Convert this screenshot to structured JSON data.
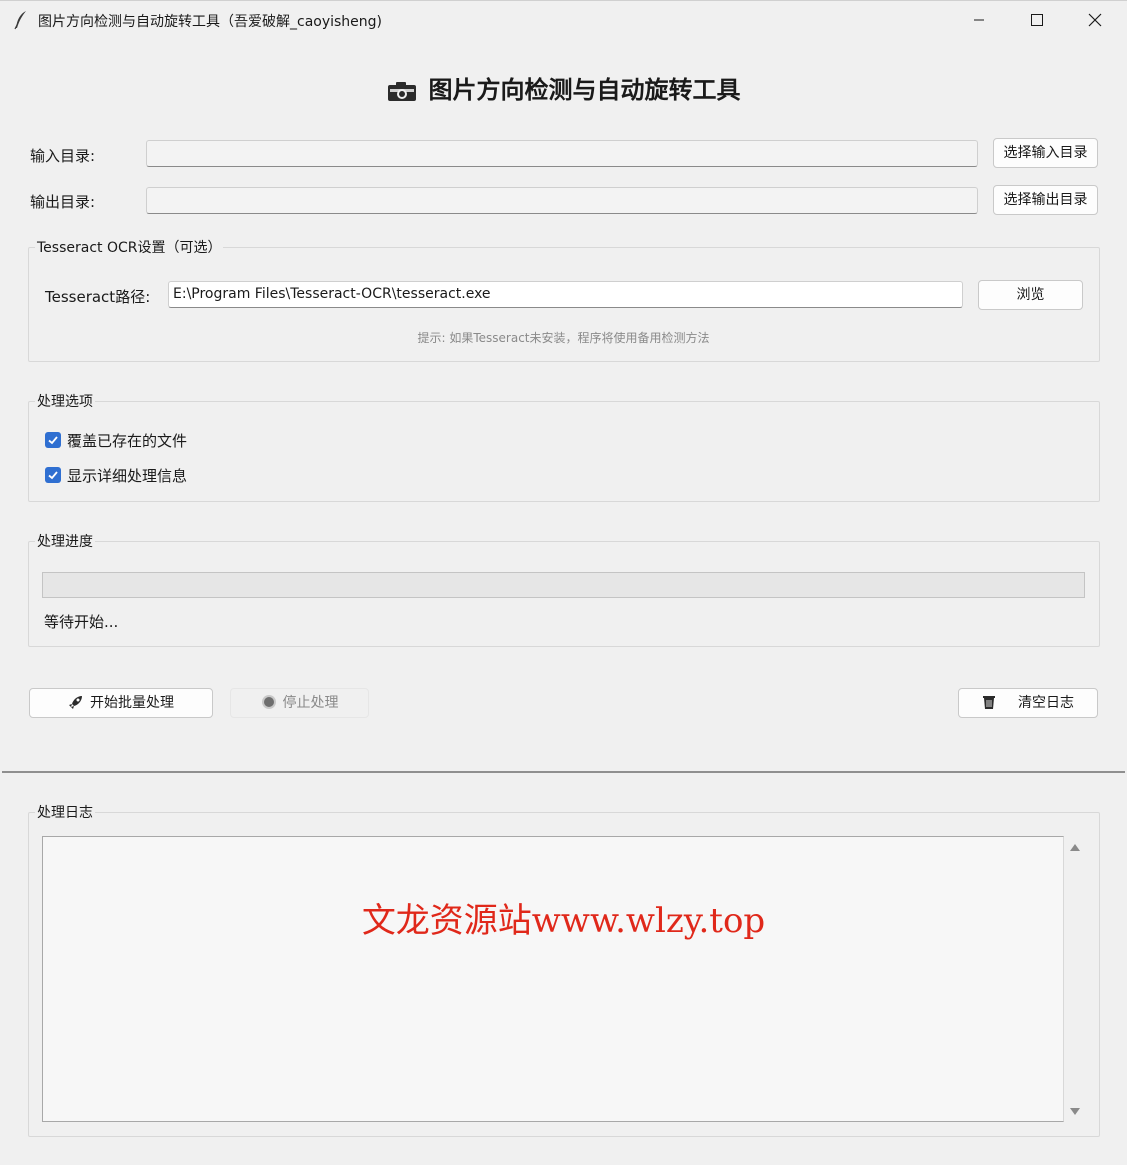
{
  "window": {
    "title": "图片方向检测与自动旋转工具（吾爱破解_caoyisheng)"
  },
  "header": {
    "title": "图片方向检测与自动旋转工具",
    "icon": "camera-icon"
  },
  "paths": {
    "input_label": "输入目录:",
    "input_value": "",
    "input_button": "选择输入目录",
    "output_label": "输出目录:",
    "output_value": "",
    "output_button": "选择输出目录"
  },
  "tesseract": {
    "group_label": "Tesseract OCR设置（可选）",
    "path_label": "Tesseract路径:",
    "path_value": "E:\\Program Files\\Tesseract-OCR\\tesseract.exe",
    "browse_button": "浏览",
    "hint": "提示: 如果Tesseract未安装，程序将使用备用检测方法"
  },
  "options": {
    "group_label": "处理选项",
    "items": [
      {
        "label": "覆盖已存在的文件",
        "checked": true
      },
      {
        "label": "显示详细处理信息",
        "checked": true
      }
    ]
  },
  "progress": {
    "group_label": "处理进度",
    "value": 0,
    "status": "等待开始..."
  },
  "actions": {
    "start_label": "开始批量处理",
    "stop_label": "停止处理",
    "clear_label": "清空日志"
  },
  "log": {
    "group_label": "处理日志",
    "watermark": "文龙资源站www.wlzy.top"
  },
  "colors": {
    "accent": "#2f6fd1",
    "watermark": "#e0281a",
    "progress_fill": "#06b025"
  }
}
